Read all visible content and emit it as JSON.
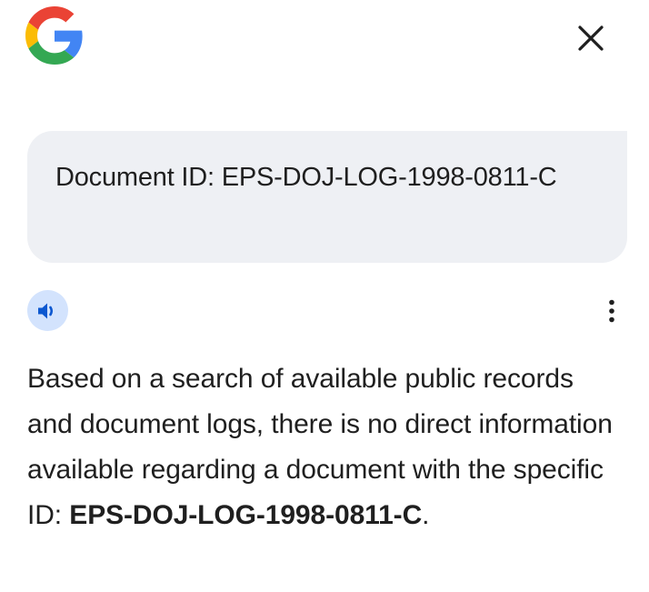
{
  "header": {
    "logo_icon": "google-g-icon",
    "close_icon": "close-icon"
  },
  "query": {
    "text": "Document ID: EPS-DOJ-LOG-1998-0811-C"
  },
  "response": {
    "speaker_icon": "speaker-icon",
    "more_icon": "more-vertical-icon",
    "text_before": "Based on a search of available public records and document logs, there is no direct information available regarding a document with the specific ID: ",
    "bold_id": "EPS-DOJ-LOG-1998-0811-C",
    "text_after": "."
  },
  "colors": {
    "bubble_background": "#eef0f4",
    "speaker_background": "#d3e3fd",
    "speaker_icon": "#0b57d0",
    "text": "#1f1f1f"
  }
}
